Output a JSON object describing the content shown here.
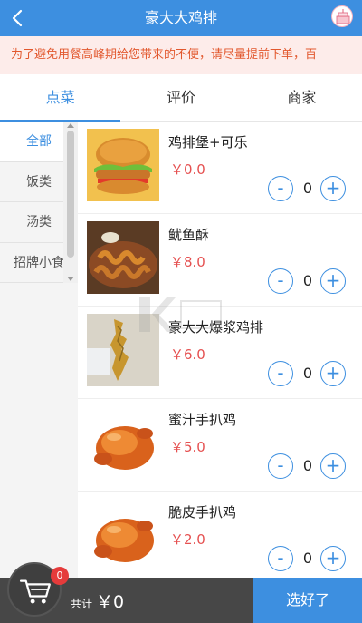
{
  "header": {
    "title": "豪大大鸡排",
    "back_icon": "chevron-left-icon",
    "brand_icon": "cake-logo-icon"
  },
  "notice": {
    "text": "为了避免用餐高峰期给您带来的不便，请尽量提前下单，百"
  },
  "tabs": [
    {
      "label": "点菜",
      "active": true
    },
    {
      "label": "评价",
      "active": false
    },
    {
      "label": "商家",
      "active": false
    }
  ],
  "categories": [
    {
      "label": "全部",
      "active": true
    },
    {
      "label": "饭类",
      "active": false
    },
    {
      "label": "汤类",
      "active": false
    },
    {
      "label": "招牌小食",
      "active": false
    }
  ],
  "items": [
    {
      "name": "鸡排堡+可乐",
      "price": "￥0.0",
      "qty": "0",
      "image": "burger"
    },
    {
      "name": "鱿鱼酥",
      "price": "￥8.0",
      "qty": "0",
      "image": "squid-fries"
    },
    {
      "name": "豪大大爆浆鸡排",
      "price": "￥6.0",
      "qty": "0",
      "image": "chicken-cutlet"
    },
    {
      "name": "蜜汁手扒鸡",
      "price": "￥5.0",
      "qty": "0",
      "image": "roast-chicken"
    },
    {
      "name": "脆皮手扒鸡",
      "price": "￥2.0",
      "qty": "0",
      "image": "roast-chicken"
    }
  ],
  "footer": {
    "total_label": "共计",
    "total_value": "￥0",
    "done_label": "选好了",
    "cart_count": "0"
  },
  "colors": {
    "primary": "#3d8fe0",
    "price": "#e55050",
    "notice_text": "#e2582e",
    "notice_bg": "#fdecea"
  }
}
